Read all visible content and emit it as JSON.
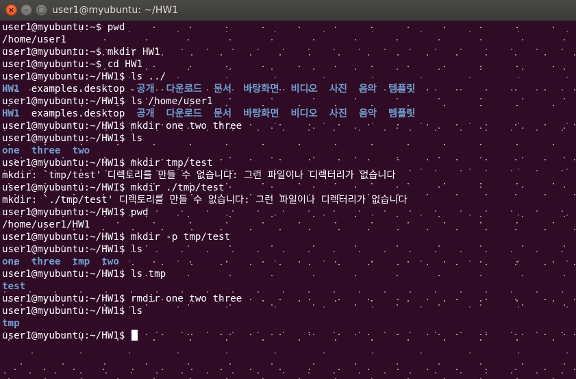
{
  "window": {
    "title": "user1@myubuntu: ~/HW1",
    "buttons": {
      "close": "×",
      "minimize": "–",
      "maximize": "▢"
    },
    "colors": {
      "background": "#2f0b26",
      "text": "#ffffff",
      "directory": "#729fcf",
      "close_button": "#e8561f"
    }
  },
  "terminal": {
    "lines": [
      {
        "segments": [
          {
            "text": "user1@myubuntu:~$ pwd",
            "type": "plain"
          }
        ]
      },
      {
        "segments": [
          {
            "text": "/home/user1",
            "type": "plain"
          }
        ]
      },
      {
        "segments": [
          {
            "text": "user1@myubuntu:~$ mkdir HW1",
            "type": "plain"
          }
        ]
      },
      {
        "segments": [
          {
            "text": "user1@myubuntu:~$ cd HW1",
            "type": "plain"
          }
        ]
      },
      {
        "segments": [
          {
            "text": "user1@myubuntu:~/HW1$ ls ../",
            "type": "plain"
          }
        ]
      },
      {
        "segments": [
          {
            "text": "HW1",
            "type": "dir"
          },
          {
            "text": "  examples.desktop  ",
            "type": "plain"
          },
          {
            "text": "공개",
            "type": "dir"
          },
          {
            "text": "  ",
            "type": "plain"
          },
          {
            "text": "다운로드",
            "type": "dir"
          },
          {
            "text": "  ",
            "type": "plain"
          },
          {
            "text": "문서",
            "type": "dir"
          },
          {
            "text": "  ",
            "type": "plain"
          },
          {
            "text": "바탕화면",
            "type": "dir"
          },
          {
            "text": "  ",
            "type": "plain"
          },
          {
            "text": "비디오",
            "type": "dir"
          },
          {
            "text": "  ",
            "type": "plain"
          },
          {
            "text": "사진",
            "type": "dir"
          },
          {
            "text": "  ",
            "type": "plain"
          },
          {
            "text": "음악",
            "type": "dir"
          },
          {
            "text": "  ",
            "type": "plain"
          },
          {
            "text": "템플릿",
            "type": "dir"
          }
        ]
      },
      {
        "segments": [
          {
            "text": "user1@myubuntu:~/HW1$ ls /home/user1",
            "type": "plain"
          }
        ]
      },
      {
        "segments": [
          {
            "text": "HW1",
            "type": "dir"
          },
          {
            "text": "  examples.desktop  ",
            "type": "plain"
          },
          {
            "text": "공개",
            "type": "dir"
          },
          {
            "text": "  ",
            "type": "plain"
          },
          {
            "text": "다운로드",
            "type": "dir"
          },
          {
            "text": "  ",
            "type": "plain"
          },
          {
            "text": "문서",
            "type": "dir"
          },
          {
            "text": "  ",
            "type": "plain"
          },
          {
            "text": "바탕화면",
            "type": "dir"
          },
          {
            "text": "  ",
            "type": "plain"
          },
          {
            "text": "비디오",
            "type": "dir"
          },
          {
            "text": "  ",
            "type": "plain"
          },
          {
            "text": "사진",
            "type": "dir"
          },
          {
            "text": "  ",
            "type": "plain"
          },
          {
            "text": "음악",
            "type": "dir"
          },
          {
            "text": "  ",
            "type": "plain"
          },
          {
            "text": "템플릿",
            "type": "dir"
          }
        ]
      },
      {
        "segments": [
          {
            "text": "user1@myubuntu:~/HW1$ mkdir one two three",
            "type": "plain"
          }
        ]
      },
      {
        "segments": [
          {
            "text": "user1@myubuntu:~/HW1$ ls",
            "type": "plain"
          }
        ]
      },
      {
        "segments": [
          {
            "text": "one",
            "type": "dir"
          },
          {
            "text": "  ",
            "type": "plain"
          },
          {
            "text": "three",
            "type": "dir"
          },
          {
            "text": "  ",
            "type": "plain"
          },
          {
            "text": "two",
            "type": "dir"
          }
        ]
      },
      {
        "segments": [
          {
            "text": "user1@myubuntu:~/HW1$ mkdir tmp/test",
            "type": "plain"
          }
        ]
      },
      {
        "segments": [
          {
            "text": "mkdir: `tmp/test' 디렉토리를 만들 수 없습니다: 그런 파일이나 디렉터리가 없습니다",
            "type": "plain"
          }
        ]
      },
      {
        "segments": [
          {
            "text": "user1@myubuntu:~/HW1$ mkdir ./tmp/test",
            "type": "plain"
          }
        ]
      },
      {
        "segments": [
          {
            "text": "mkdir: `./tmp/test' 디렉토리를 만들 수 없습니다: 그런 파일이나 디렉터리가 없습니다",
            "type": "plain"
          }
        ]
      },
      {
        "segments": [
          {
            "text": "user1@myubuntu:~/HW1$ pwd",
            "type": "plain"
          }
        ]
      },
      {
        "segments": [
          {
            "text": "/home/user1/HW1",
            "type": "plain"
          }
        ]
      },
      {
        "segments": [
          {
            "text": "user1@myubuntu:~/HW1$ mkdir -p tmp/test",
            "type": "plain"
          }
        ]
      },
      {
        "segments": [
          {
            "text": "user1@myubuntu:~/HW1$ ls",
            "type": "plain"
          }
        ]
      },
      {
        "segments": [
          {
            "text": "one",
            "type": "dir"
          },
          {
            "text": "  ",
            "type": "plain"
          },
          {
            "text": "three",
            "type": "dir"
          },
          {
            "text": "  ",
            "type": "plain"
          },
          {
            "text": "tmp",
            "type": "dir"
          },
          {
            "text": "  ",
            "type": "plain"
          },
          {
            "text": "two",
            "type": "dir"
          }
        ]
      },
      {
        "segments": [
          {
            "text": "user1@myubuntu:~/HW1$ ls tmp",
            "type": "plain"
          }
        ]
      },
      {
        "segments": [
          {
            "text": "test",
            "type": "dir"
          }
        ]
      },
      {
        "segments": [
          {
            "text": "user1@myubuntu:~/HW1$ rmdir one two three",
            "type": "plain"
          }
        ]
      },
      {
        "segments": [
          {
            "text": "user1@myubuntu:~/HW1$ ls",
            "type": "plain"
          }
        ]
      },
      {
        "segments": [
          {
            "text": "tmp",
            "type": "dir"
          }
        ]
      },
      {
        "segments": [
          {
            "text": "user1@myubuntu:~/HW1$ ",
            "type": "plain"
          }
        ],
        "cursor": true
      }
    ]
  }
}
